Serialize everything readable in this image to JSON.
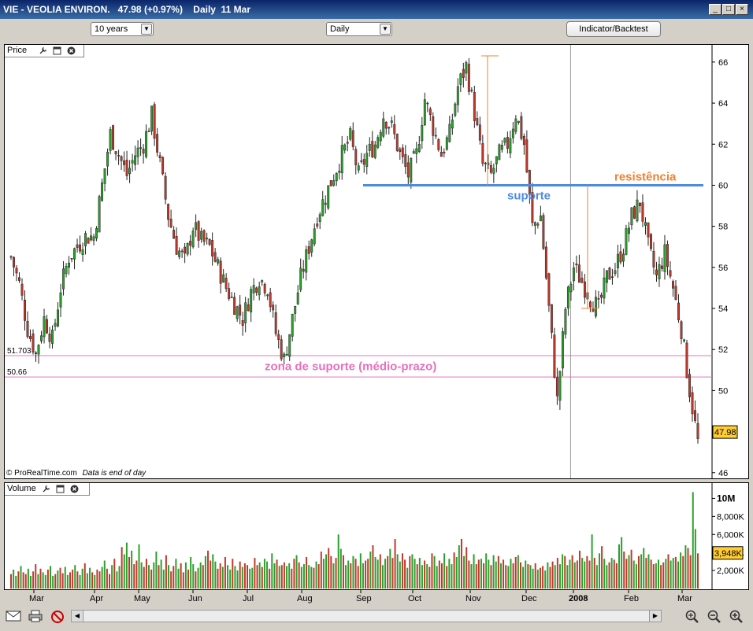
{
  "window": {
    "title": "VIE - VEOLIA ENVIRON.   47.98 (+0.97%)    Daily  11 Mar",
    "minimize": "_",
    "restore": "□",
    "close": "×"
  },
  "toolbar": {
    "period": "10 years",
    "interval": "Daily",
    "indicator_button": "Indicator/Backtest",
    "dropdown_arrow": "▼"
  },
  "price_panel": {
    "label": "Price",
    "watermark_site": "© ProRealTime.com",
    "watermark_note": "Data is end of day",
    "current_price": "47.98"
  },
  "volume_panel": {
    "label": "Volume",
    "current_volume": "3,948K"
  },
  "icons": {
    "wrench": "wrench-icon",
    "window": "window-icon",
    "close": "close-icon",
    "mail": "mail-icon",
    "print": "print-icon",
    "cancel": "cancel-icon",
    "zoom_fit": "zoom-fit-icon",
    "zoom_out": "zoom-out-icon",
    "zoom_in": "zoom-in-icon"
  },
  "colors": {
    "up": "#2ca02c",
    "down": "#c0392b",
    "support_line": "#4d8ae0",
    "resistance_text": "#f08030",
    "zone": "#e86fbf",
    "price_box": "#ffcc33"
  },
  "chart_data": [
    {
      "type": "line",
      "description_series": "VIE daily candlesticks (approx closes)",
      "x_ticks": [
        "Mar",
        "Apr",
        "May",
        "Jun",
        "Jul",
        "Aug",
        "Sep",
        "Oct",
        "Nov",
        "Dec",
        "2008",
        "Feb",
        "Mar"
      ],
      "y_ticks": [
        "46",
        "48",
        "50",
        "52",
        "54",
        "56",
        "58",
        "60",
        "62",
        "64",
        "66"
      ],
      "ylim": [
        45.8,
        66.8
      ],
      "series": [
        {
          "values": [
            56.5,
            55.2,
            53,
            51.8,
            53.5,
            52.5,
            55,
            56.5,
            57,
            57.5,
            57.5,
            60,
            62.5,
            61.5,
            60.5,
            61.5,
            62,
            63.4,
            61,
            58.5,
            57,
            56.3,
            58,
            57.3,
            57,
            56,
            55,
            54.2,
            53.5,
            54.8,
            55.5,
            55,
            52.8,
            51.5,
            53.5,
            55.5,
            57,
            58.5,
            59.5,
            60.5,
            61.5,
            62.3,
            60.5,
            61.5,
            62,
            63.4,
            62.8,
            61.5,
            60.5,
            61.5,
            64.2,
            62.8,
            61.5,
            62.5,
            64.8,
            65.8,
            63.5,
            61,
            60.5,
            61.5,
            62,
            63.5,
            62,
            58,
            58.5,
            54,
            49.5,
            54,
            56,
            55.3,
            54.5,
            54,
            55.5,
            56,
            57,
            58.5,
            59.2,
            57,
            55.5,
            56.7,
            55,
            53,
            50,
            47.5
          ]
        }
      ],
      "annotations": {
        "resistance_label": "resistência",
        "support_label": "suporte",
        "resistance_level": 60,
        "zone_label": "zona de suporte (médio-prazo)",
        "zone_upper": "51.703",
        "zone_lower": "50.66",
        "zone_upper_value": 51.703,
        "zone_lower_value": 50.66
      }
    },
    {
      "type": "bar",
      "title": "Volume",
      "y_ticks": [
        "2,000K",
        "4,000K",
        "6,000K",
        "8,000K",
        "10M"
      ],
      "ylim": [
        0,
        11000
      ],
      "units": "K",
      "values": [
        1600,
        2100,
        1400,
        1900,
        2500,
        1800,
        1600,
        2200,
        1400,
        1900,
        2700,
        1600,
        2200,
        1800,
        1500,
        2100,
        2500,
        1400,
        1600,
        2000,
        2300,
        1700,
        2400,
        1500,
        1800,
        2100,
        2600,
        1900,
        1500,
        2200,
        2800,
        1700,
        2300,
        1800,
        1500,
        2100,
        1900,
        2400,
        3100,
        2200,
        1600,
        2600,
        3300,
        1900,
        2500,
        4600,
        3800,
        5100,
        3500,
        4200,
        2700,
        3100,
        4900,
        2900,
        2400,
        3300,
        2600,
        2100,
        2900,
        4100,
        2600,
        3200,
        2100,
        3700,
        2600,
        1900,
        2500,
        3300,
        2200,
        2800,
        1800,
        2900,
        2100,
        3500,
        2700,
        1900,
        2300,
        2900,
        2600,
        3600,
        4200,
        3100,
        3800,
        3000,
        2200,
        2800,
        2400,
        3500,
        2600,
        2100,
        3300,
        2500,
        2000,
        3000,
        2400,
        2800,
        2600,
        2200,
        2300,
        3400,
        2600,
        2900,
        2400,
        3300,
        3000,
        2200,
        3900,
        2800,
        3200,
        2500,
        2600,
        2900,
        2500,
        2800,
        2200,
        3300,
        3700,
        2900,
        2400,
        2700,
        3500,
        2600,
        2400,
        2300,
        3000,
        2700,
        4100,
        3300,
        3800,
        4500,
        3600,
        2800,
        3400,
        6000,
        4400,
        3700,
        2600,
        3100,
        2800,
        3600,
        3300,
        2500,
        3900,
        2800,
        3100,
        3300,
        4100,
        4800,
        3500,
        3200,
        3800,
        2600,
        3300,
        3600,
        4400,
        3400,
        5500,
        3800,
        3000,
        3900,
        3200,
        2300,
        3600,
        3800,
        3300,
        2700,
        3400,
        2600,
        3100,
        2700,
        2400,
        3900,
        3600,
        2500,
        3100,
        2800,
        3900,
        2500,
        3300,
        2700,
        4000,
        3500,
        4800,
        5500,
        3600,
        4600,
        3100,
        2700,
        3800,
        2700,
        3200,
        3300,
        2800,
        3900,
        3200,
        2600,
        3700,
        3000,
        3600,
        2800,
        3200,
        2600,
        2500,
        3300,
        2800,
        3500,
        3700,
        2900,
        2400,
        3100,
        2700,
        2600,
        2200,
        2800,
        2100,
        2300,
        2500,
        2000,
        2900,
        2400,
        3000,
        2600,
        3400,
        2700,
        3800,
        3600,
        2600,
        3200,
        3700,
        2900,
        3100,
        4200,
        3400,
        3000,
        3600,
        3100,
        6000,
        3400,
        2600,
        3900,
        4700,
        3300,
        2600,
        2900,
        3400,
        3200,
        2800,
        4900,
        5700,
        4100,
        3300,
        3700,
        4300,
        3100,
        2700,
        3600,
        3800,
        4500,
        3400,
        3800,
        3200,
        2700,
        2800,
        3200,
        2600,
        2900,
        3300,
        3800,
        3100,
        3400,
        3500,
        3000,
        4000,
        3600,
        4800,
        4500,
        3700,
        10700,
        6600,
        3900
      ]
    }
  ]
}
